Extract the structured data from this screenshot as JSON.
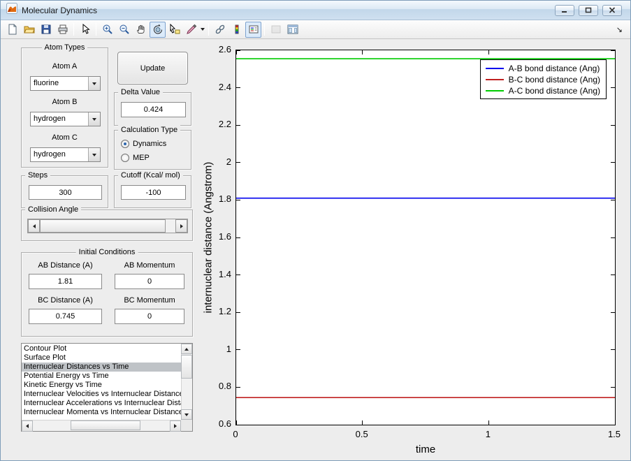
{
  "window": {
    "title": "Molecular Dynamics",
    "controls": [
      "minimize",
      "maximize",
      "close"
    ]
  },
  "toolbar": {
    "tools": [
      "new-figure",
      "open-file",
      "save-figure",
      "print-figure",
      "edit-plot",
      "zoom-in",
      "zoom-out",
      "pan",
      "rotate-3d",
      "data-cursor",
      "brush",
      "link-plot",
      "insert-colorbar",
      "insert-legend",
      "hide-plot-tools",
      "show-plot-tools"
    ],
    "active_tools": [
      "rotate-3d",
      "insert-legend"
    ],
    "disabled_tools": [
      "hide-plot-tools"
    ],
    "overflow_indicator": "↘"
  },
  "controls": {
    "atom_types": {
      "title": "Atom Types",
      "fields": [
        {
          "label": "Atom A",
          "value": "fluorine"
        },
        {
          "label": "Atom B",
          "value": "hydrogen"
        },
        {
          "label": "Atom C",
          "value": "hydrogen"
        }
      ]
    },
    "update_button": {
      "label": "Update"
    },
    "delta_value": {
      "title": "Delta Value",
      "value": "0.424"
    },
    "calculation_type": {
      "title": "Calculation Type",
      "options": [
        "Dynamics",
        "MEP"
      ],
      "selected": "Dynamics"
    },
    "steps": {
      "title": "Steps",
      "value": "300"
    },
    "cutoff": {
      "title": "Cutoff (Kcal/ mol)",
      "value": "-100"
    },
    "collision_angle": {
      "title": "Collision Angle"
    },
    "initial_conditions": {
      "title": "Initial Conditions",
      "fields": [
        {
          "label": "AB Distance (A)",
          "value": "1.81"
        },
        {
          "label": "AB Momentum",
          "value": "0"
        },
        {
          "label": "BC Distance (A)",
          "value": "0.745"
        },
        {
          "label": "BC Momentum",
          "value": "0"
        }
      ]
    },
    "plot_list": {
      "items": [
        "Contour Plot",
        "Surface Plot",
        "Internuclear Distances vs Time",
        "Potential Energy vs Time",
        "Kinetic Energy vs Time",
        "Internuclear Velocities vs Internuclear Distance",
        "Internuclear Accelerations vs Internuclear Dista",
        "Internuclear Momenta vs Internuclear Distance"
      ],
      "selected": "Internuclear Distances vs Time"
    }
  },
  "chart_data": {
    "type": "line",
    "xlabel": "time",
    "ylabel": "internuclear distance (Angstrom)",
    "xlim": [
      0,
      1.5
    ],
    "ylim": [
      0.6,
      2.6
    ],
    "x_ticks": [
      "0",
      "0.5",
      "1",
      "1.5"
    ],
    "y_ticks": [
      "0.6",
      "0.8",
      "1",
      "1.2",
      "1.4",
      "1.6",
      "1.8",
      "2",
      "2.2",
      "2.4",
      "2.6"
    ],
    "grid": false,
    "legend_position": "northeast",
    "x": [
      0,
      1.5
    ],
    "series": [
      {
        "name": "A-B bond distance (Ang)",
        "color": "#0000ee",
        "values": [
          1.81,
          1.81
        ]
      },
      {
        "name": "B-C bond distance (Ang)",
        "color": "#c02020",
        "values": [
          0.745,
          0.745
        ]
      },
      {
        "name": "A-C bond distance (Ang)",
        "color": "#00cc00",
        "values": [
          2.555,
          2.555
        ]
      }
    ]
  }
}
